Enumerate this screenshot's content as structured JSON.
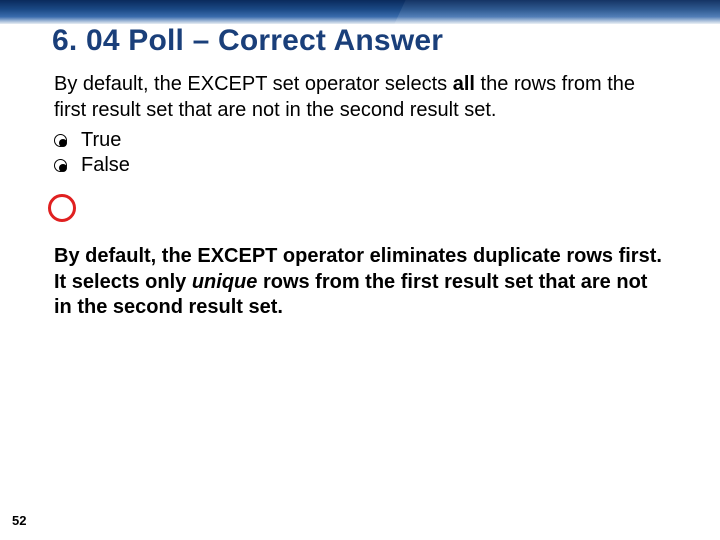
{
  "slide": {
    "title": "6. 04 Poll – Correct Answer",
    "question_pre": "By default, the EXCEPT set operator selects ",
    "question_bold": "all",
    "question_post": " the rows from the first result set that are not in the second result set.",
    "options": {
      "opt1": "True",
      "opt2": "False"
    },
    "explain_pre": "By default, the EXCEPT operator eliminates duplicate rows first. It selects only ",
    "explain_italic": "unique",
    "explain_post": " rows from the first result set that are not in the second result set.",
    "page_number": "52"
  }
}
